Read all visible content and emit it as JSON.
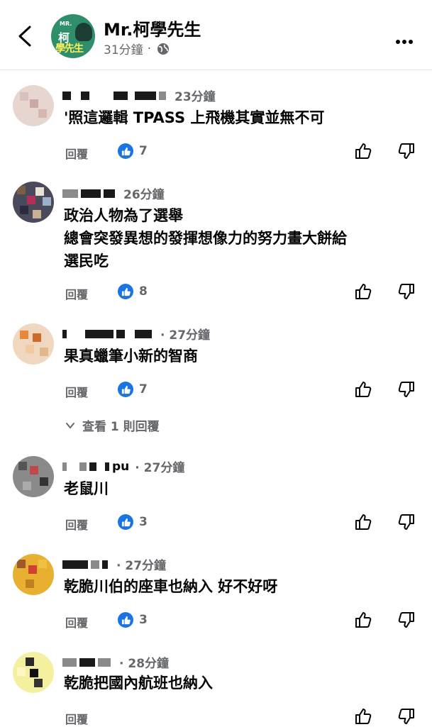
{
  "header": {
    "page_name": "Mr.柯學先生",
    "meta_time": "31分鐘",
    "meta_dot": "·",
    "avatar_text_top": "MR.",
    "avatar_text_1": "柯",
    "avatar_text_2": "學先生"
  },
  "comments": [
    {
      "time": "23分鐘",
      "lines": [
        "'照這邏輯 TPASS 上飛機其實並無不可"
      ],
      "reply": "回覆",
      "likes": "7"
    },
    {
      "time": "26分鐘",
      "lines": [
        "政治人物為了選舉",
        "總會突發異想的發揮想像力的努力畫大餅給",
        "選民吃"
      ],
      "reply": "回覆",
      "likes": "8"
    },
    {
      "time": "· 27分鐘",
      "lines": [
        "果真蠟筆小新的智商"
      ],
      "reply": "回覆",
      "likes": "7",
      "view_replies": "查看 1 則回覆"
    },
    {
      "name_suffix": "pu",
      "time": "· 27分鐘",
      "lines": [
        "老鼠川"
      ],
      "reply": "回覆",
      "likes": "3"
    },
    {
      "time": "· 27分鐘",
      "lines": [
        "乾脆川伯的座車也納入 好不好呀"
      ],
      "reply": "回覆",
      "likes": "3"
    },
    {
      "time": "· 28分鐘",
      "lines": [
        "乾脆把國內航班也納入"
      ],
      "reply": "回覆"
    }
  ],
  "icons": {
    "back": "chevron-left-icon",
    "globe": "globe-icon",
    "more": "more-icon",
    "like": "like-icon",
    "dislike": "dislike-icon"
  },
  "colors": {
    "like_blue": "#1b74e4",
    "secondary_text": "#65676b",
    "page_avatar_green": "#2f8f6a"
  }
}
